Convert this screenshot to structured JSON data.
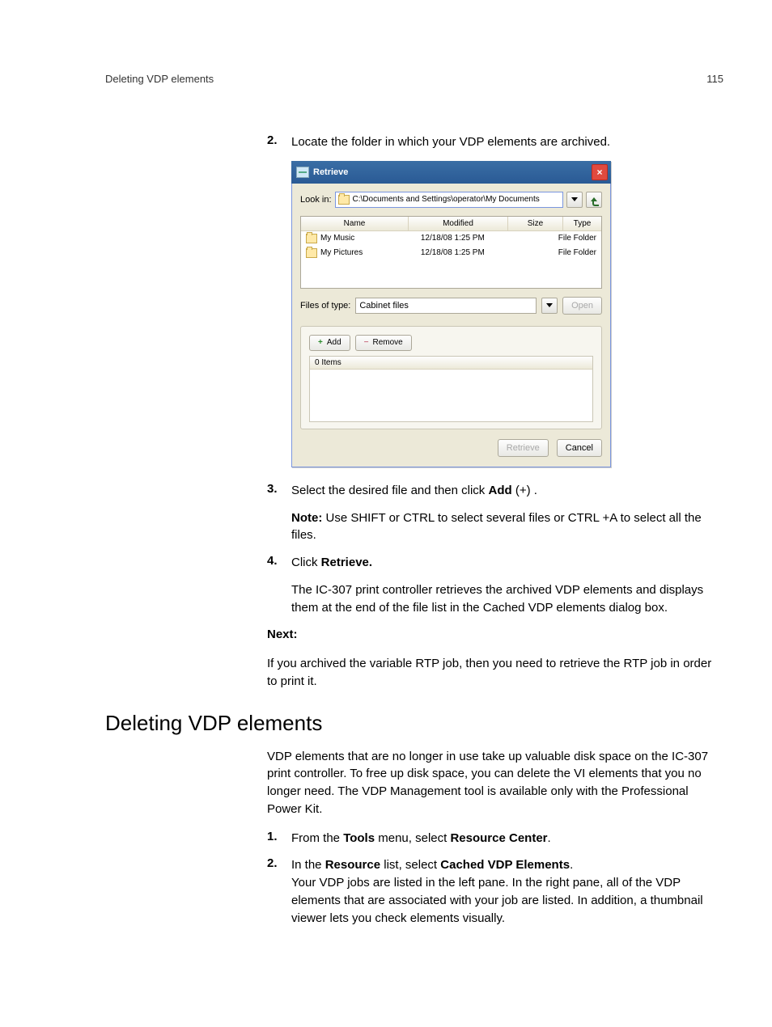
{
  "header": {
    "left": "Deleting VDP elements",
    "right": "115"
  },
  "steps": {
    "s2": {
      "num": "2.",
      "text_a": "Locate the folder in which your VDP elements are archived."
    },
    "s3": {
      "num": "3.",
      "text_a": "Select the desired file and then click ",
      "bold": "Add",
      "text_b": " (+) ."
    },
    "s3_note": {
      "label": "Note:",
      "text": " Use SHIFT or CTRL to select several files or CTRL +A to select all the files."
    },
    "s4": {
      "num": "4.",
      "text_a": "Click ",
      "bold": "Retrieve."
    },
    "s4_body": "The IC-307 print controller retrieves the archived VDP elements and displays them at the end of the file list in the Cached VDP elements dialog box.",
    "next_label": "Next:",
    "next_body": "If you archived the variable RTP job, then you need to retrieve the RTP job in order to print it."
  },
  "section": {
    "title": "Deleting VDP elements",
    "intro": "VDP elements that are no longer in use take up valuable disk space on the IC-307 print controller. To free up disk space, you can delete the VI elements that you no longer need. The VDP Management tool is available only with the Professional Power Kit.",
    "s1": {
      "num": "1.",
      "a": "From the ",
      "b": "Tools",
      "c": " menu, select ",
      "d": "Resource Center",
      "e": "."
    },
    "s2": {
      "num": "2.",
      "a": "In the ",
      "b": "Resource",
      "c": " list, select ",
      "d": "Cached VDP Elements",
      "e": ".",
      "body": "Your VDP jobs are listed in the left pane. In the right pane, all of the VDP elements that are associated with your job are listed. In addition, a thumbnail viewer lets you check elements visually."
    }
  },
  "dialog": {
    "title": "Retrieve",
    "lookin_label": "Look in:",
    "lookin_path": "C:\\Documents and Settings\\operator\\My Documents",
    "columns": {
      "name": "Name",
      "modified": "Modified",
      "size": "Size",
      "type": "Type"
    },
    "rows": [
      {
        "name": "My Music",
        "modified": "12/18/08 1:25 PM",
        "size": "",
        "type": "File Folder"
      },
      {
        "name": "My Pictures",
        "modified": "12/18/08 1:25 PM",
        "size": "",
        "type": "File Folder"
      }
    ],
    "files_of_type_label": "Files of type:",
    "files_of_type_value": "Cabinet files",
    "open": "Open",
    "add": "Add",
    "remove": "Remove",
    "items_header": "0 Items",
    "retrieve": "Retrieve",
    "cancel": "Cancel"
  }
}
